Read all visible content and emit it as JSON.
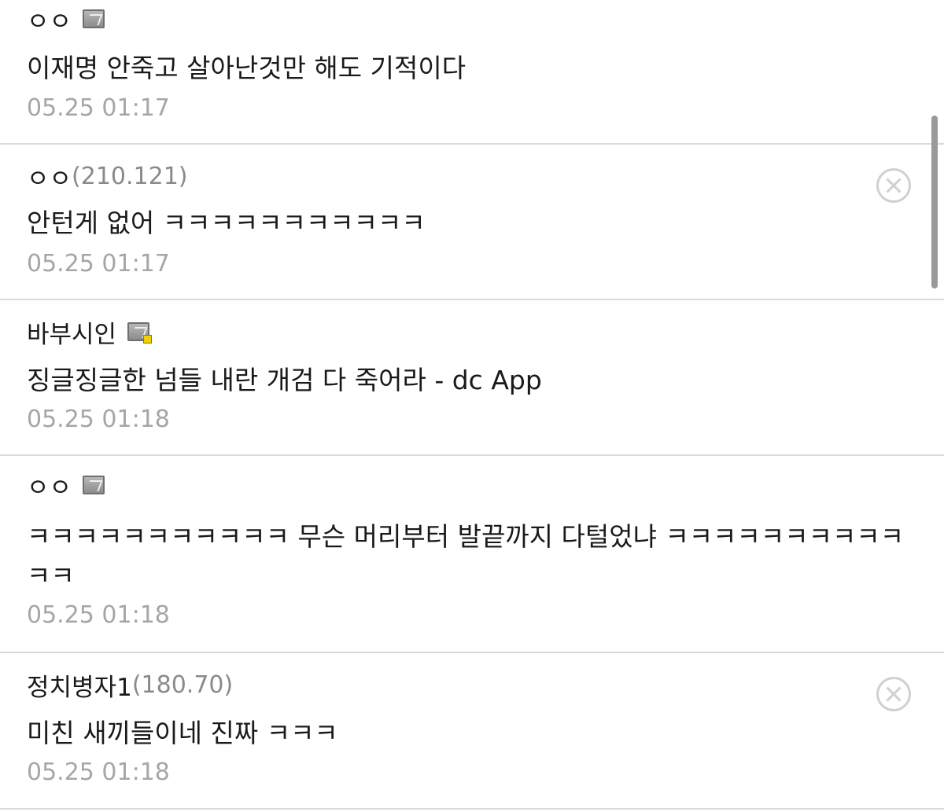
{
  "comments": [
    {
      "nick": "ㅇㅇ",
      "ip": "",
      "text": "이재명 안죽고 살아난것만 해도 기적이다",
      "time": "05.25 01:17"
    },
    {
      "nick": "ㅇㅇ",
      "ip": "(210.121)",
      "text": "안턴게 없어 ㅋㅋㅋㅋㅋㅋㅋㅋㅋㅋㅋ",
      "time": "05.25 01:17"
    },
    {
      "nick": "바부시인",
      "ip": "",
      "text": "징글징글한 넘들 내란 개검 다 죽어라 - dc App",
      "time": "05.25 01:18"
    },
    {
      "nick": "ㅇㅇ",
      "ip": "",
      "text": "ㅋㅋㅋㅋㅋㅋㅋㅋㅋㅋㅋ 무슨 머리부터 발끝까지 다털었냐 ㅋㅋㅋㅋㅋㅋㅋㅋㅋㅋㅋㅋ",
      "time": "05.25 01:18"
    },
    {
      "nick": "정치병자1",
      "ip": "(180.70)",
      "text": "미친 새끼들이네 진짜 ㅋㅋㅋ",
      "time": "05.25 01:18"
    }
  ],
  "icons": {
    "fixed_nick_badge": "fixed-nick-icon",
    "fixed_nick_badge_manager": "fixed-nick-manager-icon",
    "delete": "delete-circle-x-icon"
  },
  "colors": {
    "nick": "#1a1a1a",
    "ip": "#8a8a8a",
    "time": "#a6a6a6",
    "divider": "#d9d9e2"
  }
}
